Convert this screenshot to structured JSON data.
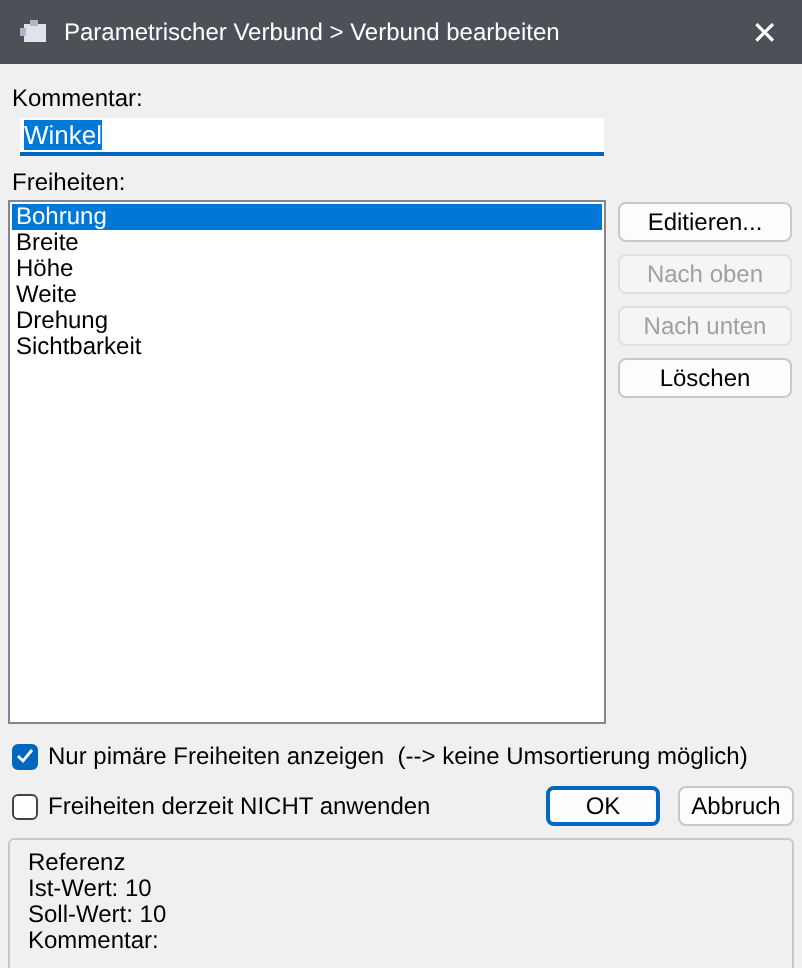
{
  "window": {
    "title": "Parametrischer Verbund > Verbund bearbeiten",
    "close": "✕"
  },
  "comment": {
    "label": "Kommentar:",
    "value": "Winkel",
    "text_selected": true
  },
  "freedoms": {
    "label": "Freiheiten:",
    "items": [
      {
        "label": "Bohrung",
        "selected": true
      },
      {
        "label": "Breite",
        "selected": false
      },
      {
        "label": "Höhe",
        "selected": false
      },
      {
        "label": "Weite",
        "selected": false
      },
      {
        "label": "Drehung",
        "selected": false
      },
      {
        "label": "Sichtbarkeit",
        "selected": false
      }
    ]
  },
  "side_buttons": [
    {
      "label": "Editieren...",
      "disabled": false
    },
    {
      "label": "Nach oben",
      "disabled": true
    },
    {
      "label": "Nach unten",
      "disabled": true
    },
    {
      "label": "Löschen",
      "disabled": false
    }
  ],
  "options": [
    {
      "label": "Nur pimäre Freiheiten anzeigen  (--> keine Umsortierung möglich)",
      "checked": true
    },
    {
      "label": "Freiheiten derzeit NICHT anwenden",
      "checked": false
    }
  ],
  "buttons": [
    {
      "label": "OK",
      "default": true
    },
    {
      "label": "Abbruch",
      "default": false
    }
  ],
  "info": [
    "Referenz",
    "Ist-Wert: 10",
    "Soll-Wert: 10",
    "Kommentar:"
  ]
}
